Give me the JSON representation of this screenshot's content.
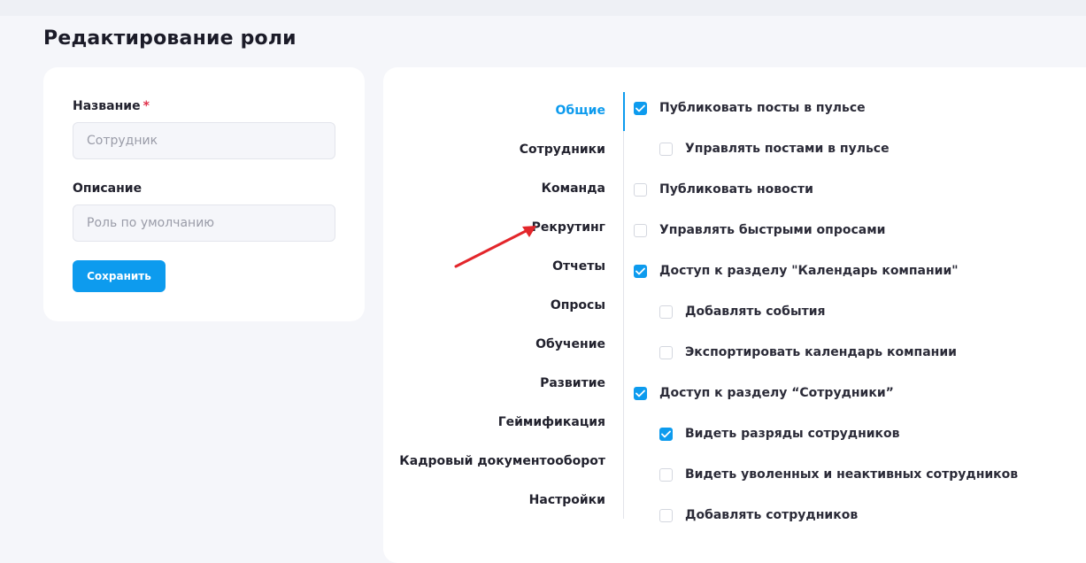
{
  "page": {
    "title": "Редактирование роли"
  },
  "form": {
    "name_label": "Название",
    "required_mark": "*",
    "name_placeholder": "Сотрудник",
    "description_label": "Описание",
    "description_placeholder": "Роль по умолчанию",
    "save_label": "Сохранить"
  },
  "sections": [
    {
      "label": "Общие",
      "active": true
    },
    {
      "label": "Сотрудники"
    },
    {
      "label": "Команда"
    },
    {
      "label": "Рекрутинг"
    },
    {
      "label": "Отчеты"
    },
    {
      "label": "Опросы"
    },
    {
      "label": "Обучение"
    },
    {
      "label": "Развитие"
    },
    {
      "label": "Геймификация"
    },
    {
      "label": "Кадровый документооборот"
    },
    {
      "label": "Настройки"
    }
  ],
  "permissions": [
    {
      "label": "Публиковать посты в пульсе",
      "checked": true,
      "level": 0
    },
    {
      "label": "Управлять постами в пульсе",
      "checked": false,
      "level": 1
    },
    {
      "label": "Публиковать новости",
      "checked": false,
      "level": 0
    },
    {
      "label": "Управлять быстрыми опросами",
      "checked": false,
      "level": 0
    },
    {
      "label": "Доступ к разделу \"Календарь компании\"",
      "checked": true,
      "level": 0
    },
    {
      "label": "Добавлять события",
      "checked": false,
      "level": 1
    },
    {
      "label": "Экспортировать календарь компании",
      "checked": false,
      "level": 1
    },
    {
      "label": "Доступ к разделу “Сотрудники”",
      "checked": true,
      "level": 0
    },
    {
      "label": "Видеть разряды сотрудников",
      "checked": true,
      "level": 1
    },
    {
      "label": "Видеть уволенных и неактивных сотрудников",
      "checked": false,
      "level": 1
    },
    {
      "label": "Добавлять сотрудников",
      "checked": false,
      "level": 1
    }
  ],
  "colors": {
    "accent": "#0d9bee",
    "required": "#e0314b",
    "annotation_arrow": "#e3262b"
  },
  "icons": {
    "checkbox_checked": "check-icon",
    "annotation": "red-arrow-icon"
  }
}
